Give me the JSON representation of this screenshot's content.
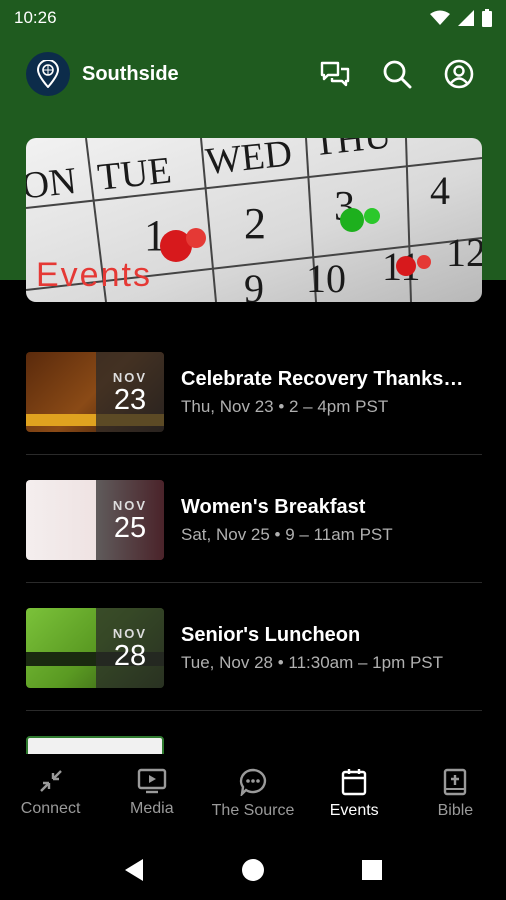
{
  "status_bar": {
    "time": "10:26",
    "icons": [
      "wifi-icon",
      "cell-signal-icon",
      "battery-icon"
    ]
  },
  "header": {
    "church_name": "Southside",
    "logo_icon": "map-pin-globe-icon",
    "actions": [
      "chat-icon",
      "search-icon",
      "account-icon"
    ]
  },
  "hero": {
    "title": "Events",
    "calendar_days": [
      "ON",
      "TUE",
      "WED",
      "THU",
      "1",
      "2",
      "3",
      "4",
      "9",
      "10",
      "11",
      "12"
    ]
  },
  "events": [
    {
      "title": "Celebrate Recovery Thanks…",
      "meta": "Thu, Nov 23 • 2 – 4pm PST",
      "month": "NOV",
      "day": "23",
      "thumb_color": "#7a3b12"
    },
    {
      "title": "Women's Breakfast",
      "meta": "Sat, Nov 25 • 9 – 11am PST",
      "month": "NOV",
      "day": "25",
      "thumb_color": "#b0213a"
    },
    {
      "title": "Senior's Luncheon",
      "meta": "Tue, Nov 28 • 11:30am – 1pm PST",
      "month": "NOV",
      "day": "28",
      "thumb_color": "#6aa82c"
    }
  ],
  "bottom_nav": [
    {
      "label": "Connect",
      "icon": "collapse-arrows-icon",
      "active": false
    },
    {
      "label": "Media",
      "icon": "play-screen-icon",
      "active": false
    },
    {
      "label": "The Source",
      "icon": "speech-bubble-icon",
      "active": false
    },
    {
      "label": "Events",
      "icon": "calendar-icon",
      "active": true
    },
    {
      "label": "Bible",
      "icon": "bible-icon",
      "active": false
    }
  ],
  "colors": {
    "header_green": "#1f5b1f",
    "background": "#000000",
    "accent_red": "#e53935"
  }
}
